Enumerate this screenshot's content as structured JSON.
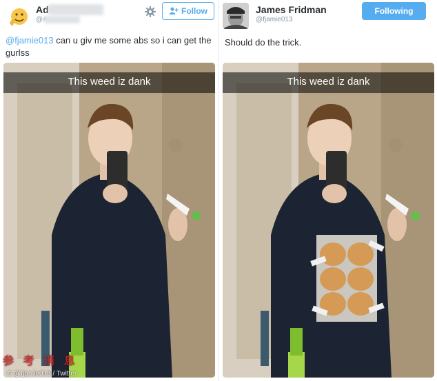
{
  "left": {
    "user": {
      "name": "Ad",
      "handle": "@A"
    },
    "follow_label": "Follow",
    "tweet": {
      "mention": "@fjamie013",
      "text": " can u giv me some abs so i can get the gurlss"
    },
    "photo_caption": "This weed iz dank"
  },
  "right": {
    "user": {
      "name": "James Fridman",
      "handle": "@fjamie013"
    },
    "following_label": "Following",
    "tweet": {
      "text": "Should do the trick."
    },
    "photo_caption": "This weed iz dank"
  },
  "footer": {
    "credit": "© @fjamie013 / Twitter",
    "watermark": "参 考 消 息"
  },
  "colors": {
    "twitter_blue": "#55acee",
    "text": "#292f33",
    "muted": "#8899a6"
  },
  "icons": [
    "avatar-emoji-icon",
    "gear-icon",
    "add-user-icon",
    "avatar-icon"
  ]
}
